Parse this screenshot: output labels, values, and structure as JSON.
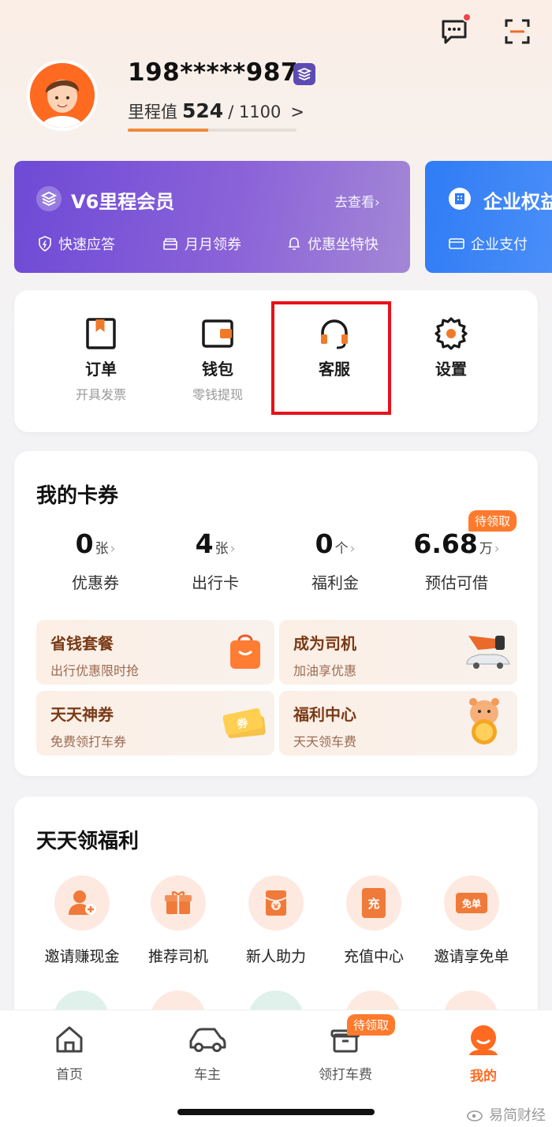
{
  "header": {
    "message_icon": "chat-bubble-icon",
    "scan_icon": "scan-icon",
    "has_unread": true
  },
  "profile": {
    "phone": "198*****987",
    "mileage_label": "里程值",
    "mileage_value": "524",
    "mileage_total": "/ 1100",
    "mileage_chevron": ">",
    "mileage_progress": 0.476
  },
  "member_card": {
    "title": "V6里程会员",
    "link": "去查看",
    "link_chevron": "›",
    "perks": [
      "快速应答",
      "月月领券",
      "优惠坐特快"
    ]
  },
  "enterprise_card": {
    "title": "企业权益",
    "sub": "企业支付"
  },
  "quick_menu": [
    {
      "label": "订单",
      "sub": "开具发票",
      "icon": "order-icon"
    },
    {
      "label": "钱包",
      "sub": "零钱提现",
      "icon": "wallet-icon"
    },
    {
      "label": "客服",
      "sub": "",
      "icon": "headset-icon"
    },
    {
      "label": "设置",
      "sub": "",
      "icon": "gear-icon"
    }
  ],
  "coupons": {
    "title": "我的卡券",
    "pending_tag": "待领取",
    "stats": [
      {
        "value": "0",
        "unit": "张",
        "chevron": "›",
        "name": "优惠券"
      },
      {
        "value": "4",
        "unit": "张",
        "chevron": "›",
        "name": "出行卡"
      },
      {
        "value": "0",
        "unit": "个",
        "chevron": "›",
        "name": "福利金"
      },
      {
        "value": "6.68",
        "unit": "万",
        "chevron": "›",
        "name": "预估可借"
      }
    ],
    "promos": [
      {
        "title": "省钱套餐",
        "sub": "出行优惠限时抢"
      },
      {
        "title": "成为司机",
        "sub": "加油享优惠"
      },
      {
        "title": "天天神券",
        "sub": "免费领打车券"
      },
      {
        "title": "福利中心",
        "sub": "天天领车费"
      }
    ],
    "coupon_art_text": "券"
  },
  "benefits": {
    "title": "天天领福利",
    "items": [
      {
        "label": "邀请赚现金",
        "icon": "invite-user-icon"
      },
      {
        "label": "推荐司机",
        "icon": "gift-box-icon"
      },
      {
        "label": "新人助力",
        "icon": "red-envelope-icon"
      },
      {
        "label": "充值中心",
        "icon": "recharge-icon",
        "glyph": "充"
      },
      {
        "label": "邀请享免单",
        "icon": "free-ticket-icon",
        "glyph": "免单"
      }
    ]
  },
  "tabbar": {
    "tabs": [
      {
        "label": "首页",
        "icon": "home-icon"
      },
      {
        "label": "车主",
        "icon": "car-icon"
      },
      {
        "label": "领打车费",
        "icon": "gift-box-icon"
      },
      {
        "label": "我的",
        "icon": "profile-icon"
      }
    ],
    "pending_tag": "待领取",
    "active_index": 3
  },
  "watermark": "易简财经",
  "colors": {
    "accent": "#ff6a21",
    "highlight": "#e8111a",
    "member_purple": "#7a55d8",
    "enterprise_blue": "#2f7cf5"
  }
}
